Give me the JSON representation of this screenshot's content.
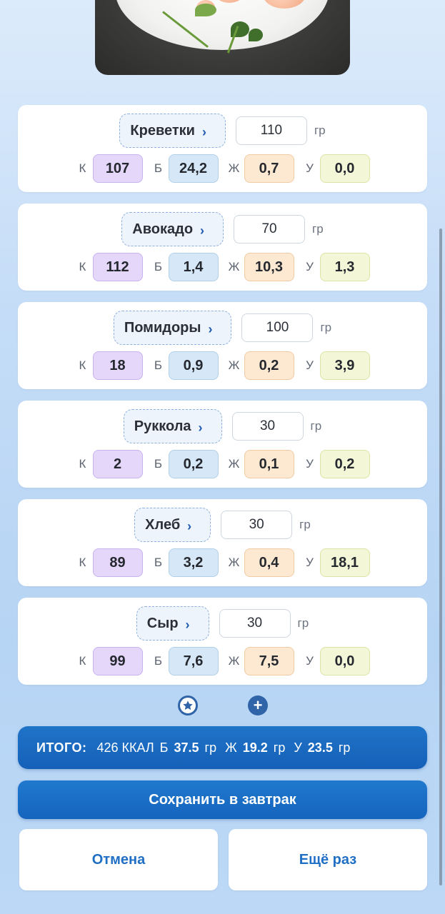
{
  "food_items": [
    {
      "name": "Креветки",
      "grams": "110",
      "unit": "гр",
      "k": "107",
      "b": "24,2",
      "j": "0,7",
      "u": "0,0"
    },
    {
      "name": "Авокадо",
      "grams": "70",
      "unit": "гр",
      "k": "112",
      "b": "1,4",
      "j": "10,3",
      "u": "1,3"
    },
    {
      "name": "Помидоры",
      "grams": "100",
      "unit": "гр",
      "k": "18",
      "b": "0,9",
      "j": "0,2",
      "u": "3,9"
    },
    {
      "name": "Руккола",
      "grams": "30",
      "unit": "гр",
      "k": "2",
      "b": "0,2",
      "j": "0,1",
      "u": "0,2"
    },
    {
      "name": "Хлеб",
      "grams": "30",
      "unit": "гр",
      "k": "89",
      "b": "3,2",
      "j": "0,4",
      "u": "18,1"
    },
    {
      "name": "Сыр",
      "grams": "30",
      "unit": "гр",
      "k": "99",
      "b": "7,6",
      "j": "7,5",
      "u": "0,0"
    }
  ],
  "macro_labels": {
    "k": "К",
    "b": "Б",
    "j": "Ж",
    "u": "У"
  },
  "chevron": "›",
  "actions": {
    "favorite_icon": "star-icon",
    "add_icon": "plus-icon",
    "add_symbol": "+"
  },
  "total": {
    "label": "ИТОГО:",
    "kcal": "426 ККАЛ",
    "b_label": "Б",
    "b_value": "37.5",
    "b_unit": "гр",
    "j_label": "Ж",
    "j_value": "19.2",
    "j_unit": "гр",
    "u_label": "У",
    "u_value": "23.5",
    "u_unit": "гр"
  },
  "buttons": {
    "save": "Сохранить в завтрак",
    "cancel": "Отмена",
    "retry": "Ещё раз"
  },
  "colors": {
    "primary": "#1f6fc4",
    "k_bg": "#e4d7fa",
    "b_bg": "#d6e8f7",
    "j_bg": "#fde8d2",
    "u_bg": "#f3f7d8"
  }
}
